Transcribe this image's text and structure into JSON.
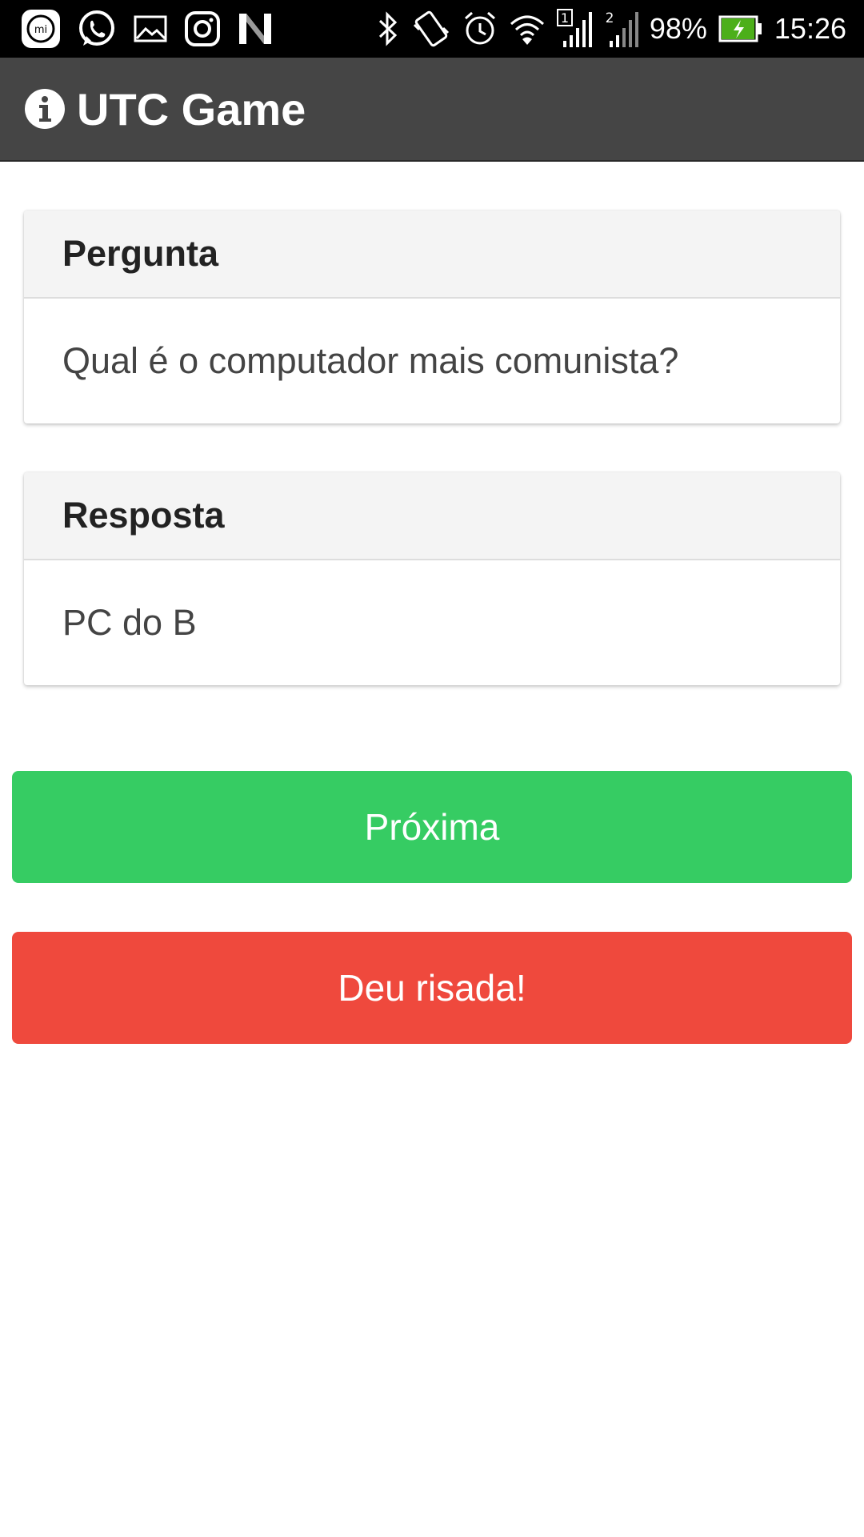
{
  "status_bar": {
    "battery_percent": "98%",
    "time": "15:26",
    "sim1_label": "1",
    "sim2_label": "2",
    "battery_level": 0.98,
    "left_icons": [
      "mi-icon",
      "whatsapp-icon",
      "gallery-icon",
      "instagram-icon",
      "n-icon"
    ],
    "right_icons": [
      "bluetooth-icon",
      "vibrate-icon",
      "alarm-icon",
      "wifi-icon",
      "signal-sim1-icon",
      "signal-sim2-icon",
      "battery-icon"
    ]
  },
  "app_bar": {
    "title": "UTC Game",
    "icon": "info-icon"
  },
  "question_card": {
    "header": "Pergunta",
    "body": "Qual é o computador mais comunista?"
  },
  "answer_card": {
    "header": "Resposta",
    "body": "PC do B"
  },
  "buttons": {
    "next_label": "Próxima",
    "laugh_label": "Deu risada!"
  },
  "colors": {
    "status_bar_bg": "#000000",
    "app_bar_bg": "#454545",
    "next_button": "#36cc63",
    "laugh_button": "#ef493d",
    "battery_fill": "#4caf1a"
  }
}
